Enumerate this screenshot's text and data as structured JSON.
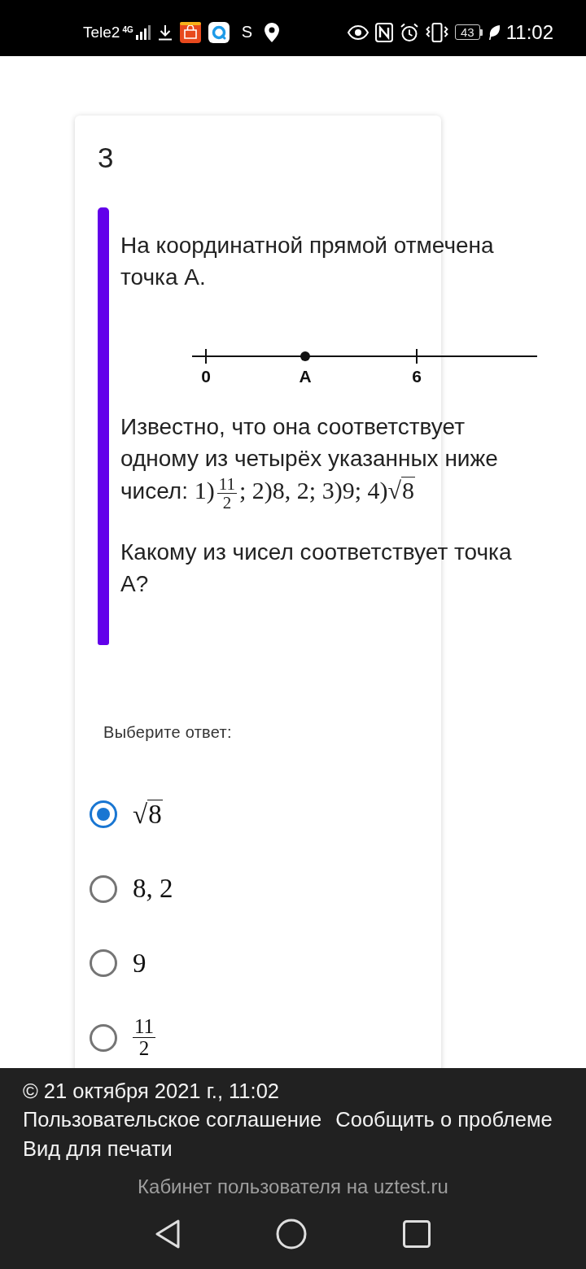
{
  "status_bar": {
    "carrier": "Tele2",
    "network": "4G",
    "notification_letter": "S",
    "battery": "43",
    "time": "11:02"
  },
  "question": {
    "number": "3",
    "intro": "На координатной прямой отмечена точка А.",
    "number_line": {
      "marks": [
        {
          "kind": "tick",
          "label": "0"
        },
        {
          "kind": "point",
          "label": "A"
        },
        {
          "kind": "tick",
          "label": "6"
        }
      ]
    },
    "statement": {
      "text": "Известно, что она соответствует одному из четырёх указанных ниже чисел:",
      "math": [
        {
          "kind": "text",
          "text": "1)"
        },
        {
          "kind": "frac",
          "numerator": "11",
          "denominator": "2"
        },
        {
          "kind": "text",
          "text": "; 2)8, 2; 3)9; 4)"
        },
        {
          "kind": "sqrt",
          "sign": "√",
          "radicand": "8"
        }
      ]
    },
    "prompt": "Какому из чисел соответствует точка А?"
  },
  "answer": {
    "label": "Выберите ответ:",
    "options": [
      {
        "selected": true,
        "value": [
          {
            "kind": "sqrt",
            "sign": "√",
            "radicand": "8"
          }
        ]
      },
      {
        "selected": false,
        "value": [
          {
            "kind": "text",
            "text": "8, 2"
          }
        ]
      },
      {
        "selected": false,
        "value": [
          {
            "kind": "text",
            "text": "9"
          }
        ]
      },
      {
        "selected": false,
        "value": [
          {
            "kind": "frac",
            "numerator": "11",
            "denominator": "2"
          }
        ]
      }
    ]
  },
  "footer": {
    "copyright": "© 21 октября 2021 г., 11:02",
    "links": [
      "Пользовательское соглашение",
      "Сообщить о проблеме",
      "Вид для печати"
    ],
    "site_link": "Кабинет пользователя на uztest.ru"
  }
}
